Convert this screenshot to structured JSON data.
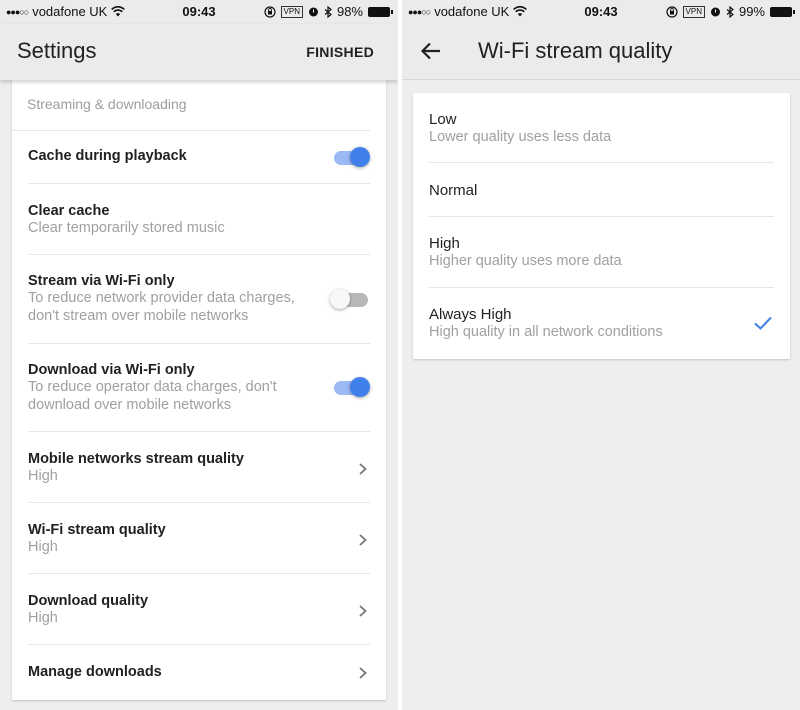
{
  "left_screen": {
    "status_bar": {
      "signal": "●●●○○",
      "carrier": "vodafone UK",
      "wifi_icon": "wifi-icon",
      "time": "09:43",
      "rotation_lock_icon": "rotation-lock-icon",
      "vpn": "VPN",
      "alarm_icon": "alarm-icon",
      "bluetooth_icon": "bluetooth-icon",
      "battery": "98%"
    },
    "app_bar": {
      "title": "Settings",
      "finished_label": "FINISHED"
    },
    "section_header": "Streaming & downloading",
    "items": [
      {
        "title": "Cache during playback",
        "subtitle": "",
        "control": "toggle",
        "on": true
      },
      {
        "title": "Clear cache",
        "subtitle": "Clear temporarily stored music",
        "control": "none"
      },
      {
        "title": "Stream via Wi-Fi only",
        "subtitle_line1": "To reduce network provider data charges,",
        "subtitle_line2": "don't stream over mobile networks",
        "control": "toggle",
        "on": false
      },
      {
        "title": "Download via Wi-Fi only",
        "subtitle_line1": "To reduce operator data charges, don't",
        "subtitle_line2": "download over mobile networks",
        "control": "toggle",
        "on": true
      },
      {
        "title": "Mobile networks stream quality",
        "subtitle": "High",
        "control": "chevron"
      },
      {
        "title": "Wi-Fi stream quality",
        "subtitle": "High",
        "control": "chevron"
      },
      {
        "title": "Download quality",
        "subtitle": "High",
        "control": "chevron"
      },
      {
        "title": "Manage downloads",
        "subtitle": "",
        "control": "chevron"
      }
    ]
  },
  "right_screen": {
    "status_bar": {
      "signal": "●●●○○",
      "carrier": "vodafone UK",
      "wifi_icon": "wifi-icon",
      "time": "09:43",
      "rotation_lock_icon": "rotation-lock-icon",
      "vpn": "VPN",
      "alarm_icon": "alarm-icon",
      "bluetooth_icon": "bluetooth-icon",
      "battery": "99%"
    },
    "app_bar": {
      "title": "Wi-Fi stream quality",
      "back_icon": "arrow-back-icon"
    },
    "options": [
      {
        "title": "Low",
        "subtitle": "Lower quality uses less data",
        "selected": false
      },
      {
        "title": "Normal",
        "subtitle": "",
        "selected": false
      },
      {
        "title": "High",
        "subtitle": "Higher quality uses more data",
        "selected": false
      },
      {
        "title": "Always High",
        "subtitle": "High quality in all network conditions",
        "selected": true
      }
    ],
    "selected_option": "Always High"
  },
  "colors": {
    "accent": "#3f80ea",
    "accent_track": "#9bb9f5",
    "background": "#eeeeee",
    "app_bar": "#ebebeb",
    "secondary_text": "#a0a0a0",
    "primary_text": "#212121"
  }
}
